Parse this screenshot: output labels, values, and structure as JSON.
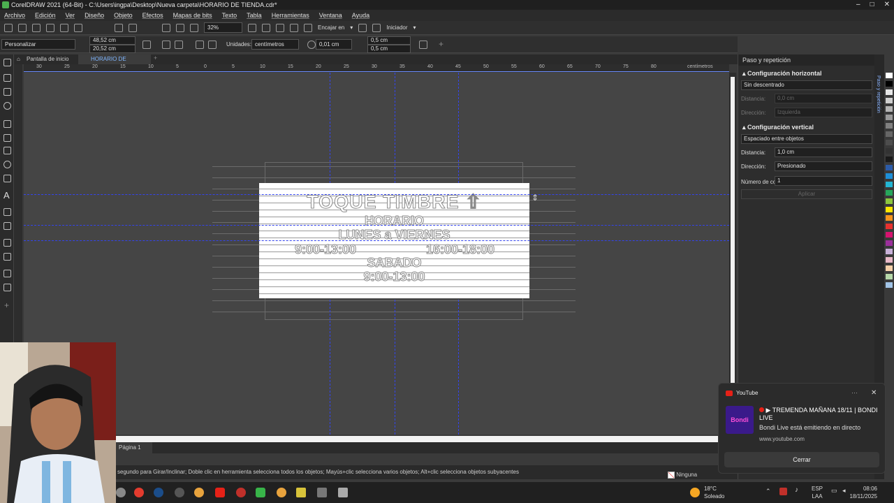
{
  "window": {
    "title": "CorelDRAW 2021 (64-Bit) - C:\\Users\\ingpa\\Desktop\\Nueva carpeta\\HORARIO DE TIENDA.cdr*"
  },
  "menu": [
    "Archivo",
    "Edición",
    "Ver",
    "Diseño",
    "Objeto",
    "Efectos",
    "Mapas de bits",
    "Texto",
    "Tabla",
    "Herramientas",
    "Ventana",
    "Ayuda"
  ],
  "toolbar": {
    "zoom": "32%",
    "snap_label": "Encajar en",
    "launch_label": "Iniciador"
  },
  "propbar": {
    "preset": "Personalizar",
    "width": "48,52 cm",
    "height": "20,52 cm",
    "units_label": "Unidades:",
    "units_value": "centímetros",
    "nudge": "0,01 cm",
    "dup_x": "0,5 cm",
    "dup_y": "0,5 cm"
  },
  "tabs": {
    "home": "Pantalla de inicio",
    "doc": "HORARIO DE TIENDA.*"
  },
  "ruler": {
    "ticks": [
      "30",
      "25",
      "20",
      "15",
      "10",
      "5",
      "0",
      "5",
      "10",
      "15",
      "20",
      "25",
      "30",
      "35",
      "40",
      "45",
      "50",
      "55",
      "60",
      "65",
      "70",
      "75",
      "80"
    ],
    "units": "centímetros"
  },
  "sign": {
    "line1": "TOQUE TIMBRE ⇧",
    "line2": "HORARIO",
    "line3": "LUNES a VIERNES",
    "line4a": "9:00-13:00",
    "line4b": "16:00-18:00",
    "line5": "SABADO",
    "line6": "9:00-13:00"
  },
  "docker": {
    "title": "Paso y repetición",
    "horizontal_title": "Configuración horizontal",
    "horizontal_mode": "Sin descentrado",
    "h_distance_label": "Distancia:",
    "h_distance_value": "0,0 cm",
    "h_direction_label": "Dirección:",
    "h_direction_value": "Izquierda",
    "vertical_title": "Configuración vertical",
    "vertical_mode": "Espaciado entre objetos",
    "v_distance_label": "Distancia:",
    "v_distance_value": "1,0 cm",
    "v_direction_label": "Dirección:",
    "v_direction_value": "Presionado",
    "copies_label": "Número de copias:",
    "copies_value": "1",
    "apply_label": "Aplicar",
    "side_tab": "Paso y repetición"
  },
  "page_tab": "Página 1",
  "status": {
    "hint": "segundo para Girar/Inclinar; Doble clic en herramienta selecciona todos los objetos; Mayús+clic selecciona varios objetos; Alt+clic selecciona objetos subyacentes",
    "fill": "Ninguna"
  },
  "notification": {
    "app": "YouTube",
    "title": "▶ TREMENDA MAÑANA 18/11 | BONDI LIVE",
    "body": "Bondi Live está emitiendo en directo",
    "url": "www.youtube.com",
    "button": "Cerrar",
    "thumb_text": "Bondi"
  },
  "taskbar": {
    "weather_temp": "18°C",
    "weather_desc": "Soleado",
    "lang": "ESP",
    "lang2": "LAA",
    "time": "08:06",
    "date": "18/11/2025"
  }
}
